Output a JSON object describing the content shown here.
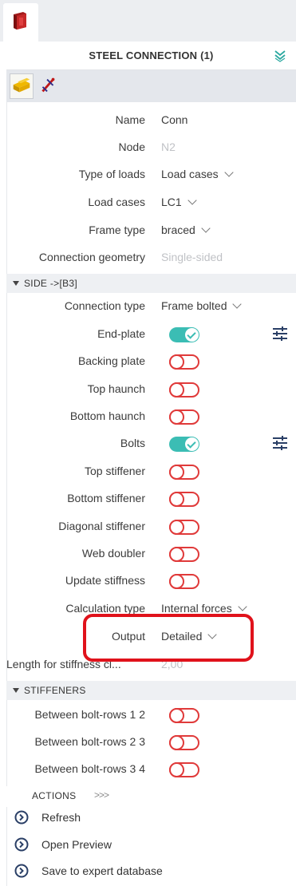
{
  "panel": {
    "title": "STEEL CONNECTION (1)"
  },
  "properties": {
    "name": {
      "label": "Name",
      "value": "Conn"
    },
    "node": {
      "label": "Node",
      "value": "N2"
    },
    "type_of_loads": {
      "label": "Type of loads",
      "value": "Load cases"
    },
    "load_cases": {
      "label": "Load cases",
      "value": "LC1"
    },
    "frame_type": {
      "label": "Frame type",
      "value": "braced"
    },
    "connection_geometry": {
      "label": "Connection geometry",
      "value": "Single-sided"
    }
  },
  "side_section": {
    "title": "SIDE ->[B3]",
    "connection_type": {
      "label": "Connection type",
      "value": "Frame bolted"
    },
    "toggles": [
      {
        "label": "End-plate",
        "on": true,
        "has_settings": true
      },
      {
        "label": "Backing plate",
        "on": false
      },
      {
        "label": "Top haunch",
        "on": false
      },
      {
        "label": "Bottom haunch",
        "on": false
      },
      {
        "label": "Bolts",
        "on": true,
        "has_settings": true
      },
      {
        "label": "Top stiffener",
        "on": false
      },
      {
        "label": "Bottom stiffener",
        "on": false
      },
      {
        "label": "Diagonal stiffener",
        "on": false
      },
      {
        "label": "Web doubler",
        "on": false
      },
      {
        "label": "Update stiffness",
        "on": false
      }
    ],
    "calculation_type": {
      "label": "Calculation type",
      "value": "Internal forces"
    },
    "output": {
      "label": "Output",
      "value": "Detailed"
    },
    "length_for_stiffness": {
      "label": "Length for stiffness cl...",
      "value": "2,00"
    }
  },
  "stiffeners_section": {
    "title": "STIFFENERS",
    "toggles": [
      {
        "label": "Between bolt-rows 1 2",
        "on": false
      },
      {
        "label": "Between bolt-rows 2 3",
        "on": false
      },
      {
        "label": "Between bolt-rows 3 4",
        "on": false
      }
    ]
  },
  "actions": {
    "title": "ACTIONS",
    "more": ">>>",
    "items": [
      {
        "label": "Refresh"
      },
      {
        "label": "Open Preview"
      },
      {
        "label": "Save to expert database"
      }
    ]
  },
  "colors": {
    "accent": "#3bbdb4",
    "toggle_off": "#e03a3a",
    "highlight": "#e0121b"
  },
  "icons": [
    "app-connection-icon",
    "collapse-icon",
    "steel-connection-tool-icon",
    "pin-tool-icon",
    "settings-sliders-icon",
    "action-arrow-icon"
  ]
}
